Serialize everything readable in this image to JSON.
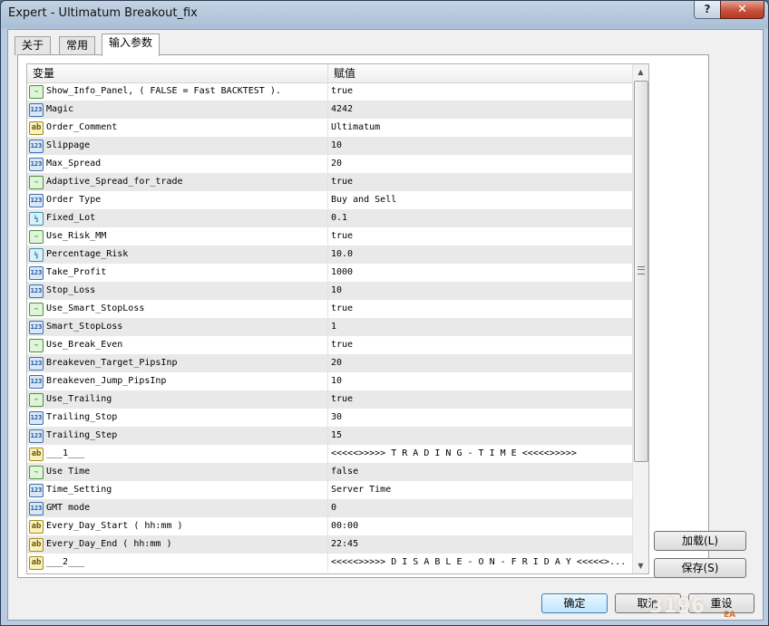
{
  "window": {
    "title": "Expert - Ultimatum Breakout_fix",
    "help_label": "?",
    "close_label": "✕"
  },
  "tabs": [
    {
      "label": "关于"
    },
    {
      "label": "常用"
    },
    {
      "label": "输入参数"
    }
  ],
  "table": {
    "headers": {
      "variable": "变量",
      "value": "赋值"
    },
    "rows": [
      {
        "type": "bool",
        "icon": "bool-icon",
        "variable": "Show_Info_Panel, ( FALSE = Fast BACKTEST ).",
        "value": "true"
      },
      {
        "type": "int",
        "icon": "int-icon",
        "variable": "Magic",
        "value": "4242"
      },
      {
        "type": "str",
        "icon": "string-icon",
        "variable": "Order_Comment",
        "value": "Ultimatum"
      },
      {
        "type": "int",
        "icon": "int-icon",
        "variable": "Slippage",
        "value": "10"
      },
      {
        "type": "int",
        "icon": "int-icon",
        "variable": "Max_Spread",
        "value": "20"
      },
      {
        "type": "bool",
        "icon": "bool-icon",
        "variable": "Adaptive_Spread_for_trade",
        "value": "true"
      },
      {
        "type": "int",
        "icon": "int-icon",
        "variable": "Order Type",
        "value": "Buy and Sell"
      },
      {
        "type": "dbl",
        "icon": "double-icon",
        "variable": "Fixed_Lot",
        "value": "0.1"
      },
      {
        "type": "bool",
        "icon": "bool-icon",
        "variable": "Use_Risk_MM",
        "value": "true"
      },
      {
        "type": "dbl",
        "icon": "double-icon",
        "variable": "Percentage_Risk",
        "value": "10.0"
      },
      {
        "type": "int",
        "icon": "int-icon",
        "variable": "Take_Profit",
        "value": "1000"
      },
      {
        "type": "int",
        "icon": "int-icon",
        "variable": "Stop_Loss",
        "value": "10"
      },
      {
        "type": "bool",
        "icon": "bool-icon",
        "variable": "Use_Smart_StopLoss",
        "value": "true"
      },
      {
        "type": "int",
        "icon": "int-icon",
        "variable": "Smart_StopLoss",
        "value": "1"
      },
      {
        "type": "bool",
        "icon": "bool-icon",
        "variable": "Use_Break_Even",
        "value": "true"
      },
      {
        "type": "int",
        "icon": "int-icon",
        "variable": "Breakeven_Target_PipsInp",
        "value": "20"
      },
      {
        "type": "int",
        "icon": "int-icon",
        "variable": "Breakeven_Jump_PipsInp",
        "value": "10"
      },
      {
        "type": "bool",
        "icon": "bool-icon",
        "variable": "Use_Trailing",
        "value": "true"
      },
      {
        "type": "int",
        "icon": "int-icon",
        "variable": "Trailing_Stop",
        "value": "30"
      },
      {
        "type": "int",
        "icon": "int-icon",
        "variable": "Trailing_Step",
        "value": "15"
      },
      {
        "type": "str",
        "icon": "string-icon",
        "variable": "___1___",
        "value": "<<<<<>>>>> T R A D I N G - T I M E <<<<<>>>>>"
      },
      {
        "type": "bool",
        "icon": "bool-icon",
        "variable": "Use Time",
        "value": "false"
      },
      {
        "type": "int",
        "icon": "int-icon",
        "variable": "Time_Setting",
        "value": "Server Time"
      },
      {
        "type": "int",
        "icon": "int-icon",
        "variable": "GMT mode",
        "value": "0"
      },
      {
        "type": "str",
        "icon": "string-icon",
        "variable": "Every_Day_Start ( hh:mm )",
        "value": "00:00"
      },
      {
        "type": "str",
        "icon": "string-icon",
        "variable": "Every_Day_End ( hh:mm )",
        "value": "22:45"
      },
      {
        "type": "str",
        "icon": "string-icon",
        "variable": "___2___",
        "value": "<<<<<>>>>> D I S A B L E - O N - F R I D A Y <<<<<>..."
      }
    ]
  },
  "icon_glyphs": {
    "bool": "~",
    "int": "123",
    "dbl": "½",
    "str": "ab"
  },
  "buttons": {
    "load": "加载(L)",
    "save": "保存(S)",
    "ok": "确定",
    "cancel": "取消",
    "reset": "重设"
  },
  "watermark": {
    "text": "3196",
    "sub": "EA"
  },
  "colors": {
    "accent": "#3c7fb1",
    "alt_row": "#e9e9e9"
  }
}
